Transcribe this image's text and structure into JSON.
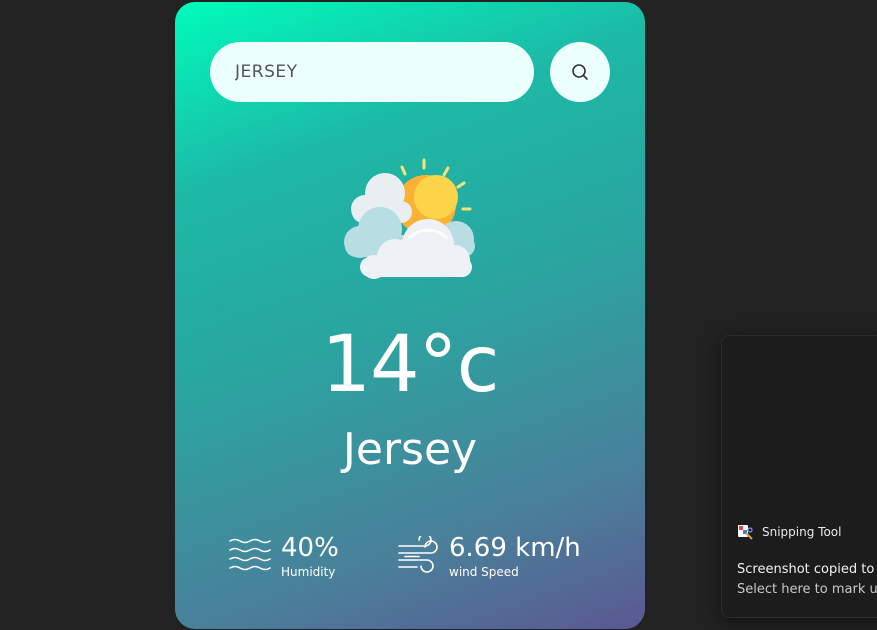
{
  "search": {
    "value": "JERSEY",
    "icon": "search-icon"
  },
  "weather": {
    "condition_icon": "partly-cloudy-icon",
    "temperature": "14°c",
    "city": "Jersey"
  },
  "details": {
    "humidity_value": "40%",
    "humidity_label": "Humidity",
    "humidity_icon": "humidity-waves-icon",
    "wind_value": "6.69 km/h",
    "wind_label": "wind Speed",
    "wind_icon": "wind-icon"
  },
  "notification": {
    "app_name": "Snipping Tool",
    "app_icon": "snipping-tool-icon",
    "title": "Screenshot copied to c",
    "body": "Select here to mark up"
  },
  "colors": {
    "page_bg": "#222222",
    "card_gradient_start": "#00fcbb",
    "card_gradient_end": "#5b5892",
    "input_bg": "#ebfffc"
  }
}
